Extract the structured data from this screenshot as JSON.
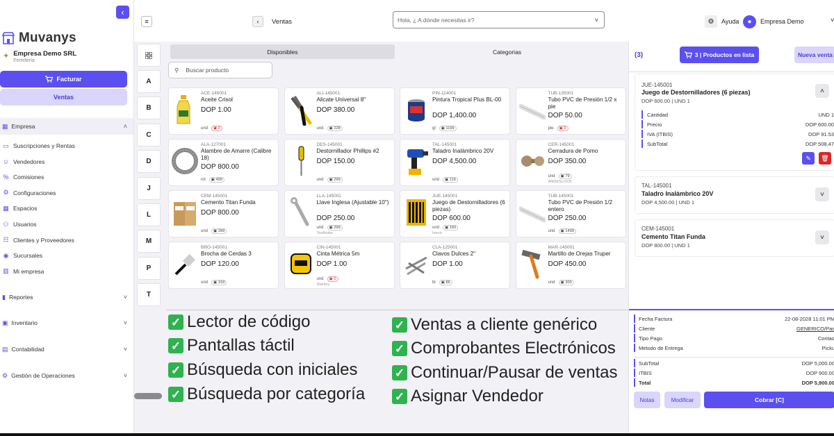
{
  "colors": {
    "accent": "#5b4ff0",
    "accent_soft": "#d9d5fb",
    "check": "#2fb24f",
    "danger": "#dc2626"
  },
  "sidebar": {
    "brand": "Muvanys",
    "company_name": "Empresa Demo SRL",
    "company_type": "Ferretería",
    "facturar_label": "Facturar",
    "ventas_label": "Ventas",
    "empresa_label": "Empresa",
    "empresa_items": [
      {
        "label": "Suscripciones y Rentas",
        "icon": "card-icon"
      },
      {
        "label": "Vendedores",
        "icon": "users-icon"
      },
      {
        "label": "Comisiones",
        "icon": "percent-icon"
      },
      {
        "label": "Configuraciones",
        "icon": "gear-icon"
      },
      {
        "label": "Espacios",
        "icon": "grid-icon"
      },
      {
        "label": "Usuarios",
        "icon": "user-icon"
      },
      {
        "label": "Clientes y Proveedores",
        "icon": "contacts-icon"
      },
      {
        "label": "Sucursales",
        "icon": "location-icon"
      },
      {
        "label": "Mi empresa",
        "icon": "building-icon"
      }
    ],
    "sections": [
      {
        "label": "Reportes",
        "icon": "bar-chart-icon"
      },
      {
        "label": "Inventario",
        "icon": "box-icon"
      },
      {
        "label": "Contabilidad",
        "icon": "ledger-icon"
      },
      {
        "label": "Gestión de Operaciones",
        "icon": "operations-icon"
      }
    ]
  },
  "topbar": {
    "page_title": "Ventas",
    "search_placeholder": "Hola, ¿ A dónde necesitas ir?",
    "help_label": "Ayuda",
    "user_name": "Empresa Demo"
  },
  "main": {
    "categories": [
      "A",
      "B",
      "C",
      "D",
      "J",
      "L",
      "M",
      "P",
      "T"
    ],
    "tabs": [
      "Disponibles",
      "Categorias"
    ],
    "search_placeholder": "Buscar producto",
    "products": [
      {
        "code": "ACE-145001",
        "name": "Aceite Crisol",
        "price": "DOP 1.00",
        "unit": "und",
        "stock": "0",
        "low": true,
        "brand": "",
        "img": "oil-bottle"
      },
      {
        "code": "ALI-145001",
        "name": "Alicate Universal 8\"",
        "price": "DOP 380.00",
        "unit": "und",
        "stock": "228",
        "low": false,
        "brand": "",
        "img": "pliers"
      },
      {
        "code": "PIN-114001",
        "name": "Pintura Tropical Plus BL-00",
        "price": "DOP 1,400.00",
        "unit": "gl",
        "stock": "1199",
        "low": false,
        "brand": "",
        "img": "paint-can"
      },
      {
        "code": "TUB-135001",
        "name": "Tubo PVC de Presión 1/2 x pie",
        "price": "DOP 50.00",
        "unit": "pie",
        "stock": "0",
        "low": true,
        "brand": "",
        "img": "pipe"
      },
      {
        "code": "ALA-127001",
        "name": "Alambre de Amarre (Calibre 18)",
        "price": "DOP 800.00",
        "unit": "rol",
        "stock": "499",
        "low": false,
        "brand": "",
        "img": "wire"
      },
      {
        "code": "DES-145001",
        "name": "Destornillador Phillips #2",
        "price": "DOP 150.00",
        "unit": "und",
        "stock": "299",
        "low": false,
        "brand": "",
        "img": "screwdriver"
      },
      {
        "code": "TAL-145001",
        "name": "Taladro Inalámbrico 20V",
        "price": "DOP 4,500.00",
        "unit": "und",
        "stock": "119",
        "low": false,
        "brand": "",
        "img": "drill"
      },
      {
        "code": "CER-145001",
        "name": "Cerradura de Pomo",
        "price": "DOP 350.00",
        "unit": "und",
        "stock": "79",
        "low": false,
        "brand": "ANDESLOCK",
        "img": "lock"
      },
      {
        "code": "CEM-145001",
        "name": "Cemento Titan Funda",
        "price": "DOP 800.00",
        "unit": "und",
        "stock": "399",
        "low": false,
        "brand": "",
        "img": "cement"
      },
      {
        "code": "LLA-145001",
        "name": "Llave Inglesa (Ajustable 10\")",
        "price": "DOP 250.00",
        "unit": "und",
        "stock": "299",
        "low": false,
        "brand": "ToolHubs",
        "img": "wrench"
      },
      {
        "code": "JUE-145001",
        "name": "Juego de Destornilladores (6 piezas)",
        "price": "DOP 600.00",
        "unit": "und",
        "stock": "160",
        "low": false,
        "brand": "Ineco",
        "img": "screwdriver-set"
      },
      {
        "code": "TUB-145001",
        "name": "Tubo PVC de Presión 1/2 entero",
        "price": "DOP 250.00",
        "unit": "und",
        "stock": "1499",
        "low": false,
        "brand": "",
        "img": "pipe"
      },
      {
        "code": "BRO-145001",
        "name": "Brocha de Cerdas 3",
        "price": "DOP 120.00",
        "unit": "und",
        "stock": "318",
        "low": false,
        "brand": "",
        "img": "brush"
      },
      {
        "code": "CIN-145001",
        "name": "Cinta Métrica 5m",
        "price": "DOP 1.00",
        "unit": "und",
        "stock": "0",
        "low": true,
        "brand": "Stanley",
        "img": "tape"
      },
      {
        "code": "CLA-125001",
        "name": "Clavos Dulces 2\"",
        "price": "DOP 1.00",
        "unit": "lb",
        "stock": "86",
        "low": false,
        "brand": "",
        "img": "nails"
      },
      {
        "code": "MAR-145001",
        "name": "Martillo de Orejas Truper",
        "price": "DOP 450.00",
        "unit": "und",
        "stock": "300",
        "low": false,
        "brand": "",
        "img": "hammer"
      }
    ],
    "features": [
      "Lector de código",
      "Pantallas táctil",
      "Búsqueda con iniciales",
      "Búsqueda por categoría",
      "Ventas a cliente genérico",
      "Comprobantes Electrónicos",
      "Continuar/Pausar de ventas",
      "Asignar Vendedor"
    ]
  },
  "cart": {
    "count": "(3)",
    "products_button": "3 | Productos en lista",
    "new_sale_button": "Nueva venta",
    "items": [
      {
        "code": "JUE-145001",
        "name": "Juego de Destornilladores (6 piezas)",
        "sub": "DOP 600.00 | UND 1"
      },
      {
        "code": "TAL-145001",
        "name": "Taladro Inalámbrico 20V",
        "sub": "DOP 4,500.00 | UND 1"
      },
      {
        "code": "CEM-145001",
        "name": "Cemento Titan Funda",
        "sub": "DOP 800.00 | UND 1"
      }
    ],
    "detail": [
      {
        "label": "Cantidad",
        "value": "UND 1"
      },
      {
        "label": "Precio",
        "value": "DOP 600.00"
      },
      {
        "label": "IVA (ITBIS)",
        "value": "DOP 91.53"
      },
      {
        "label": "SubTotal",
        "value": "DOP 508.47"
      }
    ],
    "info": [
      {
        "label": "Fecha Factura",
        "value": "22-08-2028 11:01 PM"
      },
      {
        "label": "Cliente",
        "value": "GENERICO/Pas"
      },
      {
        "label": "Tipo Pago",
        "value": "Contad"
      },
      {
        "label": "Metodo de Entrega",
        "value": "Picku"
      }
    ],
    "totals": [
      {
        "label": "SubTotal",
        "value": "DOP 5,000.00"
      },
      {
        "label": "ITBIS",
        "value": "DOP 900.00"
      },
      {
        "label": "Total",
        "value": "DOP 5,900.00"
      }
    ],
    "notes_button": "Notas",
    "modify_button": "Modificar",
    "charge_button": "Cobrar [C]"
  }
}
